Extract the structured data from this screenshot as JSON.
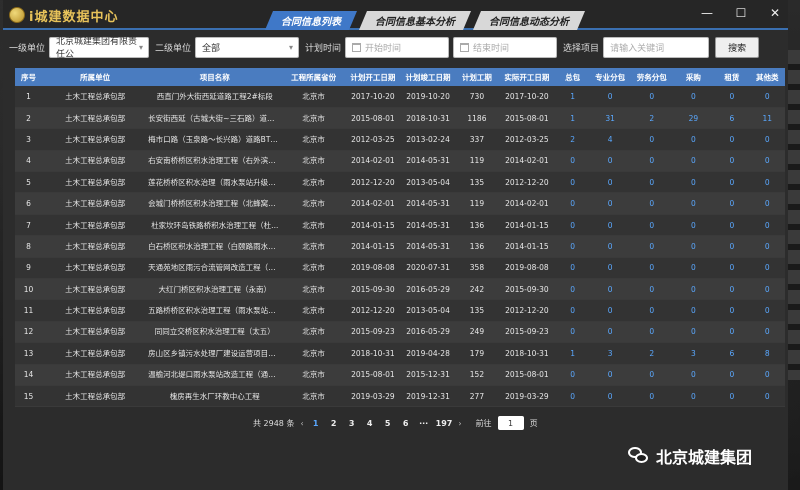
{
  "app": {
    "title": "i城建数据中心"
  },
  "tabs": [
    {
      "label": "合同信息列表",
      "active": true
    },
    {
      "label": "合同信息基本分析",
      "active": false
    },
    {
      "label": "合同信息动态分析",
      "active": false
    }
  ],
  "window_controls": {
    "minimize": "—",
    "maximize": "☐",
    "close": "✕"
  },
  "filters": {
    "level1_label": "一级单位",
    "level1_value": "北京城建集团有限责任公",
    "level2_label": "二级单位",
    "level2_value": "全部",
    "plan_time_label": "计划时间",
    "start_placeholder": "开始时间",
    "end_placeholder": "结束时间",
    "project_label": "选择项目",
    "keyword_placeholder": "请输入关键词",
    "search_button": "搜索"
  },
  "table": {
    "columns": [
      "序号",
      "所属单位",
      "项目名称",
      "工程所属省份",
      "计划开工日期",
      "计划竣工日期",
      "计划工期",
      "实际开工日期",
      "总包",
      "专业分包",
      "劳务分包",
      "采购",
      "租赁",
      "其他类"
    ],
    "rows": [
      [
        "1",
        "土木工程总承包部",
        "西直门外大街西延道路工程2#标段",
        "北京市",
        "2017-10-20",
        "2019-10-20",
        "730",
        "2017-10-20",
        "1",
        "0",
        "0",
        "0",
        "0",
        "0"
      ],
      [
        "2",
        "土木工程总承包部",
        "长安街西延（古城大街~三石路）道路工...",
        "北京市",
        "2015-08-01",
        "2018-10-31",
        "1186",
        "2015-08-01",
        "1",
        "31",
        "2",
        "29",
        "6",
        "11"
      ],
      [
        "3",
        "土木工程总承包部",
        "梅市口路（玉泉路～长兴路）道路BT工程",
        "北京市",
        "2012-03-25",
        "2013-02-24",
        "337",
        "2012-03-25",
        "2",
        "4",
        "0",
        "0",
        "0",
        "0"
      ],
      [
        "4",
        "土木工程总承包部",
        "右安南桥桥区积水治理工程（右外滨水泵...",
        "北京市",
        "2014-02-01",
        "2014-05-31",
        "119",
        "2014-02-01",
        "0",
        "0",
        "0",
        "0",
        "0",
        "0"
      ],
      [
        "5",
        "土木工程总承包部",
        "莲花桥桥区积水治理（雨水泵站升级改造...",
        "北京市",
        "2012-12-20",
        "2013-05-04",
        "135",
        "2012-12-20",
        "0",
        "0",
        "0",
        "0",
        "0",
        "0"
      ],
      [
        "6",
        "土木工程总承包部",
        "会城门桥桥区积水治理工程（北蜂窝雨水...",
        "北京市",
        "2014-02-01",
        "2014-05-31",
        "119",
        "2014-02-01",
        "0",
        "0",
        "0",
        "0",
        "0",
        "0"
      ],
      [
        "7",
        "土木工程总承包部",
        "杜家坎环岛铁路桥积水治理工程（杜...",
        "北京市",
        "2014-01-15",
        "2014-05-31",
        "136",
        "2014-01-15",
        "0",
        "0",
        "0",
        "0",
        "0",
        "0"
      ],
      [
        "8",
        "土木工程总承包部",
        "白石桥区积水治理工程（白颐路雨水泵站...",
        "北京市",
        "2014-01-15",
        "2014-05-31",
        "136",
        "2014-01-15",
        "0",
        "0",
        "0",
        "0",
        "0",
        "0"
      ],
      [
        "9",
        "土木工程总承包部",
        "天通苑地区雨污合流管网改造工程（白坊...",
        "北京市",
        "2019-08-08",
        "2020-07-31",
        "358",
        "2019-08-08",
        "0",
        "0",
        "0",
        "0",
        "0",
        "0"
      ],
      [
        "10",
        "土木工程总承包部",
        "大红门桥区积水治理工程（永南）",
        "北京市",
        "2015-09-30",
        "2016-05-29",
        "242",
        "2015-09-30",
        "0",
        "0",
        "0",
        "0",
        "0",
        "0"
      ],
      [
        "11",
        "土木工程总承包部",
        "五路桥桥区积水治理工程（雨水泵站升级改造...",
        "北京市",
        "2012-12-20",
        "2013-05-04",
        "135",
        "2012-12-20",
        "0",
        "0",
        "0",
        "0",
        "0",
        "0"
      ],
      [
        "12",
        "土木工程总承包部",
        "同同立交桥区积水治理工程（太五）",
        "北京市",
        "2015-09-23",
        "2016-05-29",
        "249",
        "2015-09-23",
        "0",
        "0",
        "0",
        "0",
        "0",
        "0"
      ],
      [
        "13",
        "土木工程总承包部",
        "房山区乡镇污水处理厂建设运营项目十渡...",
        "北京市",
        "2018-10-31",
        "2019-04-28",
        "179",
        "2018-10-31",
        "1",
        "3",
        "2",
        "3",
        "6",
        "8"
      ],
      [
        "14",
        "土木工程总承包部",
        "温榆河北堤口雨水泵站改造工程（通州）",
        "北京市",
        "2015-08-01",
        "2015-12-31",
        "152",
        "2015-08-01",
        "0",
        "0",
        "0",
        "0",
        "0",
        "0"
      ],
      [
        "15",
        "土木工程总承包部",
        "槐房再生水厂环教中心工程",
        "北京市",
        "2019-03-29",
        "2019-12-31",
        "277",
        "2019-03-29",
        "0",
        "0",
        "0",
        "0",
        "0",
        "0"
      ]
    ]
  },
  "pagination": {
    "total": "共 2948 条",
    "prev": "‹",
    "pages": [
      "1",
      "2",
      "3",
      "4",
      "5",
      "6",
      "···",
      "197"
    ],
    "current": "1",
    "next": "›",
    "goto_label": "前往",
    "goto_value": "1",
    "page_unit": "页"
  },
  "watermark": {
    "text": "北京城建集团"
  }
}
